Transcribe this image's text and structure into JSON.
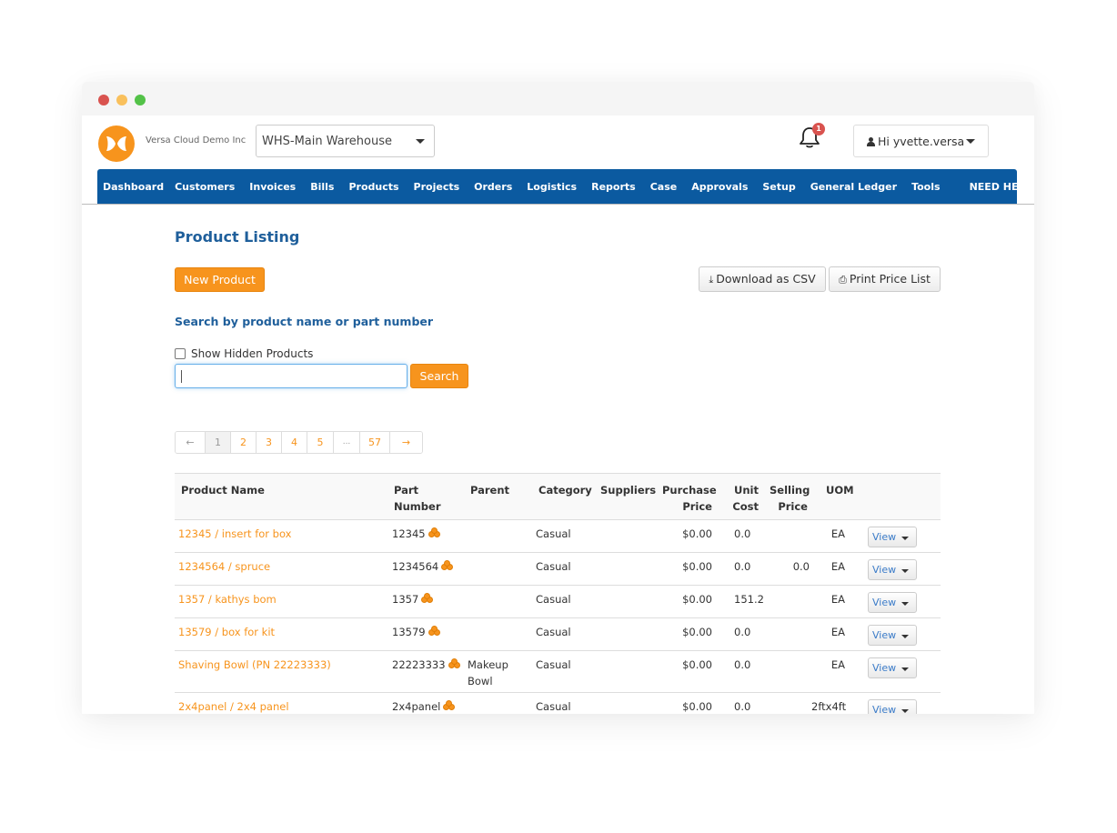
{
  "window": {
    "traffic_lights": [
      "close",
      "minimize",
      "maximize"
    ]
  },
  "header": {
    "company": "Versa Cloud Demo Inc",
    "warehouse_select": "WHS-Main Warehouse",
    "notification_count": "1",
    "user_greeting": "Hi yvette.versa"
  },
  "nav": {
    "items": [
      "Dashboard",
      "Customers",
      "Invoices",
      "Bills",
      "Products",
      "Projects",
      "Orders",
      "Logistics",
      "Reports",
      "Case",
      "Approvals",
      "Setup",
      "General Ledger",
      "Tools",
      "NEED HELP"
    ],
    "help_icon": "question-circle-icon"
  },
  "page": {
    "title": "Product Listing",
    "new_product_label": "New Product",
    "download_csv_label": "Download as CSV",
    "print_price_list_label": "Print Price List",
    "search_label": "Search by product name or part number",
    "show_hidden_label": "Show Hidden Products",
    "search_value": "",
    "search_button_label": "Search"
  },
  "pagination": {
    "prev": "←",
    "pages": [
      "1",
      "2",
      "3",
      "4",
      "5",
      "...",
      "57"
    ],
    "next": "→",
    "current": "1"
  },
  "table": {
    "headers": {
      "product_name": "Product Name",
      "part_number": "Part\nNumber",
      "parent": "Parent",
      "category": "Category",
      "suppliers": "Suppliers",
      "purchase_price": "Purchase\nPrice",
      "unit_cost": "Unit\nCost",
      "selling_price": "Selling\nPrice",
      "uom": "UOM"
    },
    "rows": [
      {
        "name": "12345 / insert for box",
        "part": "12345",
        "parent": "",
        "category": "Casual",
        "suppliers": "",
        "purchase": "$0.00",
        "unit_cost": "0.0",
        "selling": "",
        "uom": "EA",
        "action": "View"
      },
      {
        "name": "1234564 / spruce",
        "part": "1234564",
        "parent": "",
        "category": "Casual",
        "suppliers": "",
        "purchase": "$0.00",
        "unit_cost": "0.0",
        "selling": "0.0",
        "uom": "EA",
        "action": "View"
      },
      {
        "name": "1357 / kathys bom",
        "part": "1357",
        "parent": "",
        "category": "Casual",
        "suppliers": "",
        "purchase": "$0.00",
        "unit_cost": "151.2",
        "selling": "",
        "uom": "EA",
        "action": "View"
      },
      {
        "name": "13579 / box for kit",
        "part": "13579",
        "parent": "",
        "category": "Casual",
        "suppliers": "",
        "purchase": "$0.00",
        "unit_cost": "0.0",
        "selling": "",
        "uom": "EA",
        "action": "View"
      },
      {
        "name": "Shaving Bowl (PN 22223333)",
        "part": "22223333",
        "parent": "Makeup Bowl",
        "category": "Casual",
        "suppliers": "",
        "purchase": "$0.00",
        "unit_cost": "0.0",
        "selling": "",
        "uom": "EA",
        "action": "View"
      },
      {
        "name": "2x4panel / 2x4 panel",
        "part": "2x4panel",
        "parent": "",
        "category": "Casual",
        "suppliers": "",
        "purchase": "$0.00",
        "unit_cost": "0.0",
        "selling": "",
        "uom": "2ftx4ft",
        "action": "View"
      }
    ]
  },
  "colors": {
    "brand_orange": "#f7941d",
    "nav_blue": "#0b5aa0",
    "heading_blue": "#1f5f9b",
    "badge_red": "#d9534f"
  }
}
